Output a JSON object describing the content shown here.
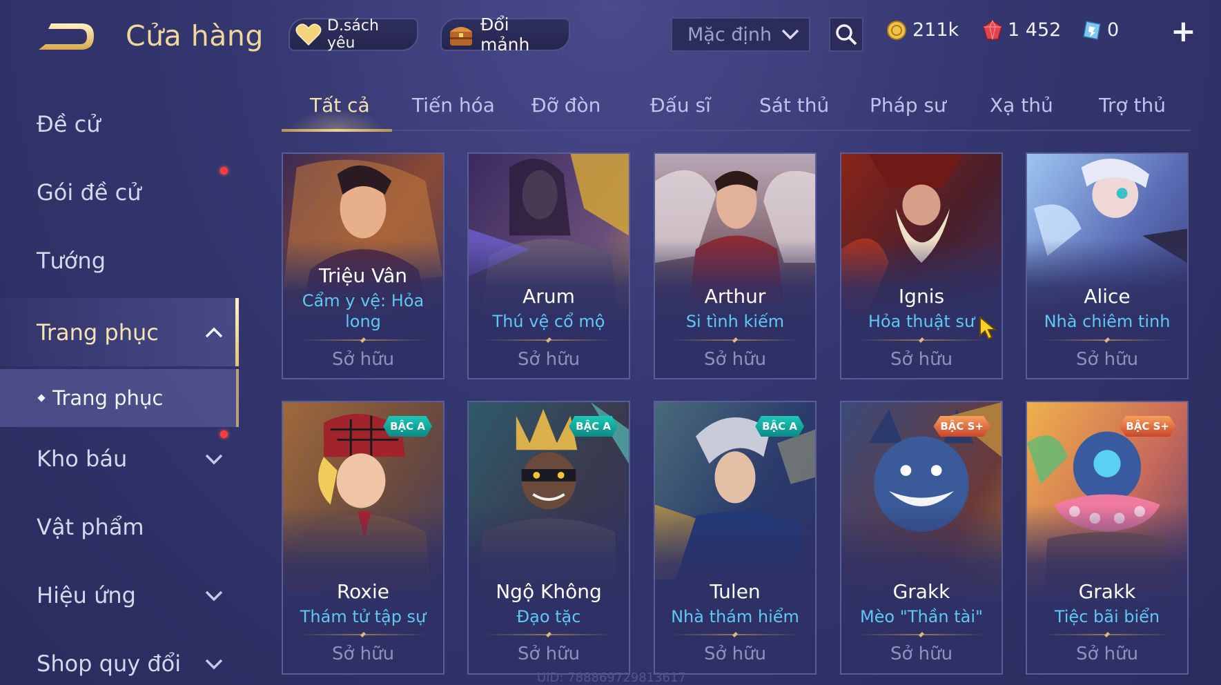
{
  "header": {
    "title": "Cửa hàng",
    "wishlist_label": "D.sách yêu",
    "shards_label": "Đổi mảnh",
    "sort_value": "Mặc định",
    "currencies": {
      "gold": "211k",
      "gem": "1 452",
      "coupon": "0"
    },
    "add_label": "+"
  },
  "sidebar": {
    "items": [
      {
        "label": "Đề cử"
      },
      {
        "label": "Gói đề cử"
      },
      {
        "label": "Tướng"
      },
      {
        "label": "Trang phục"
      },
      {
        "label": "Kho báu"
      },
      {
        "label": "Vật phẩm"
      },
      {
        "label": "Hiệu ứng"
      },
      {
        "label": "Shop quy đổi"
      }
    ],
    "sub_item": "Trang phục"
  },
  "tabs": [
    "Tất cả",
    "Tiến hóa",
    "Đỡ đòn",
    "Đấu sĩ",
    "Sát thủ",
    "Pháp sư",
    "Xạ thủ",
    "Trợ thủ"
  ],
  "cards": [
    {
      "hero": "Triệu Vân",
      "skin": "Cẩm y vệ: Hỏa long",
      "status": "Sở hữu"
    },
    {
      "hero": "Arum",
      "skin": "Thú vệ cổ mộ",
      "status": "Sở hữu"
    },
    {
      "hero": "Arthur",
      "skin": "Si tình kiếm",
      "status": "Sở hữu"
    },
    {
      "hero": "Ignis",
      "skin": "Hỏa thuật sư",
      "status": "Sở hữu"
    },
    {
      "hero": "Alice",
      "skin": "Nhà chiêm tinh",
      "status": "Sở hữu"
    },
    {
      "hero": "Roxie",
      "skin": "Thám tử tập sự",
      "status": "Sở hữu",
      "tier": "BẬC A"
    },
    {
      "hero": "Ngộ Không",
      "skin": "Đạo tặc",
      "status": "Sở hữu",
      "tier": "BẬC A"
    },
    {
      "hero": "Tulen",
      "skin": "Nhà thám hiểm",
      "status": "Sở hữu",
      "tier": "BẬC A"
    },
    {
      "hero": "Grakk",
      "skin": "Mèo \"Thần tài\"",
      "status": "Sở hữu",
      "tier": "BẬC S+"
    },
    {
      "hero": "Grakk",
      "skin": "Tiệc bãi biển",
      "status": "Sở hữu",
      "tier": "BẬC S+"
    }
  ],
  "uid": "UID: 788869729813617",
  "colors": {
    "accent_gold": "#f0d79b",
    "skin_name_blue": "#5ec8f0",
    "tier_a": "#1ec7b6",
    "tier_s": "#e5623a",
    "notification_red": "#ff3b3b"
  },
  "icons": [
    "back-arrow-icon",
    "heart-icon",
    "treasure-chest-icon",
    "chevron-down-icon",
    "search-icon",
    "gold-coin-icon",
    "red-gem-icon",
    "coupon-icon",
    "plus-icon",
    "chevron-up-icon",
    "cursor-icon"
  ]
}
